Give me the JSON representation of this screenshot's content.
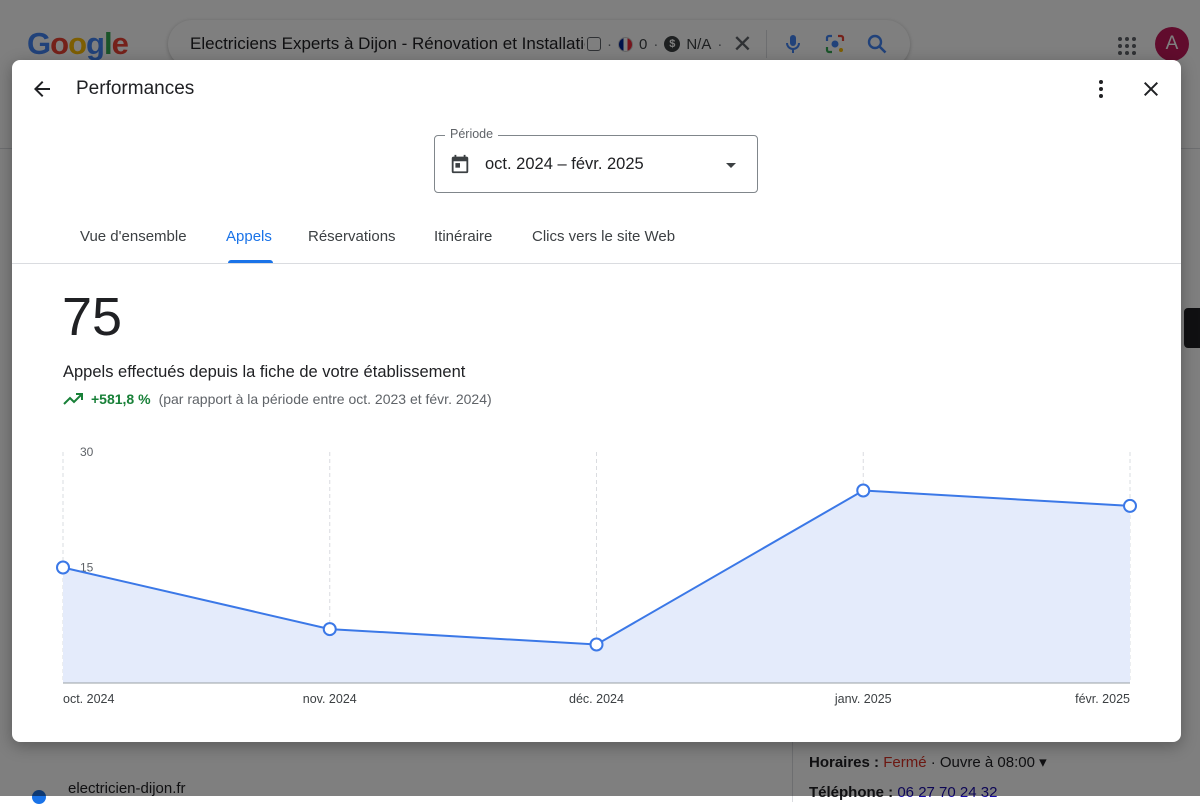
{
  "background": {
    "logo_letters": [
      {
        "ch": "G",
        "color": "#4285F4"
      },
      {
        "ch": "o",
        "color": "#EA4335"
      },
      {
        "ch": "o",
        "color": "#FBBC05"
      },
      {
        "ch": "g",
        "color": "#4285F4"
      },
      {
        "ch": "l",
        "color": "#34A853"
      },
      {
        "ch": "e",
        "color": "#EA4335"
      }
    ],
    "search_query": "Electriciens Experts à Dijon - Rénovation et Installation",
    "ext_count": "0",
    "ext_value": "N/A",
    "ext_dollar": "$",
    "dot": "·",
    "clear_glyph": "✕",
    "avatar_letter": "A",
    "url_text": "electricien-dijon.fr",
    "hours_label": "Horaires :",
    "hours_status": "Fermé",
    "hours_open": "· Ouvre à 08:00 ▾",
    "phone_label": "Téléphone :",
    "phone_value": "06 27 70 24 32"
  },
  "dialog": {
    "title": "Performances",
    "period": {
      "label": "Période",
      "value": "oct. 2024 – févr. 2025"
    },
    "tabs": [
      {
        "label": "Vue d'ensemble",
        "active": false
      },
      {
        "label": "Appels",
        "active": true
      },
      {
        "label": "Réservations",
        "active": false
      },
      {
        "label": "Itinéraire",
        "active": false
      },
      {
        "label": "Clics vers le site Web",
        "active": false
      }
    ],
    "metric": {
      "value": "75",
      "description": "Appels effectués depuis la fiche de votre établissement",
      "change": "+581,8 %",
      "comparison": "(par rapport à la période entre oct. 2023 et févr. 2024)"
    }
  },
  "colors": {
    "accent": "#1a73e8",
    "line": "#3b78e7",
    "area": "#e4ebfb",
    "positive": "#188038"
  },
  "chart_data": {
    "type": "area",
    "categories": [
      "oct. 2024",
      "nov. 2024",
      "déc. 2024",
      "janv. 2025",
      "févr. 2025"
    ],
    "values": [
      15,
      7,
      5,
      25,
      23
    ],
    "y_ticks": [
      "15",
      "30"
    ],
    "ylim": [
      0,
      30
    ],
    "grid": "vertical-dashed",
    "xlabel": "",
    "ylabel": ""
  }
}
